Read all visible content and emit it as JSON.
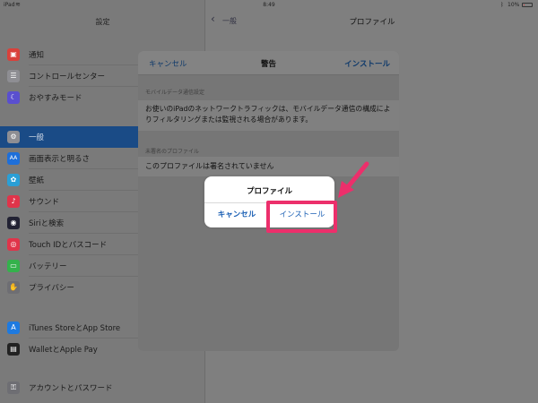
{
  "status_bar": {
    "carrier": "iPad",
    "time": "8:49",
    "battery": "10%"
  },
  "sidebar": {
    "title": "設定",
    "items": [
      {
        "label": "通知",
        "icon": "notifications-icon",
        "color": "#d9413b"
      },
      {
        "label": "コントロールセンター",
        "icon": "control-center-icon",
        "color": "#8e8e93"
      },
      {
        "label": "おやすみモード",
        "icon": "moon-icon",
        "color": "#5a4fcf"
      },
      {
        "label": "一般",
        "icon": "gear-icon",
        "color": "#8e8e93"
      },
      {
        "label": "画面表示と明るさ",
        "icon": "display-icon",
        "color": "#1e6fd9"
      },
      {
        "label": "壁紙",
        "icon": "wallpaper-icon",
        "color": "#2a9fd6"
      },
      {
        "label": "サウンド",
        "icon": "sound-icon",
        "color": "#e0344a"
      },
      {
        "label": "Siriと検索",
        "icon": "siri-icon",
        "color": "#222233"
      },
      {
        "label": "Touch IDとパスコード",
        "icon": "fingerprint-icon",
        "color": "#e0344a"
      },
      {
        "label": "バッテリー",
        "icon": "battery-icon",
        "color": "#34b24c"
      },
      {
        "label": "プライバシー",
        "icon": "privacy-hand-icon",
        "color": "#6e6e73"
      },
      {
        "label": "iTunes StoreとApp Store",
        "icon": "app-store-icon",
        "color": "#1e7ae0"
      },
      {
        "label": "WalletとApple Pay",
        "icon": "wallet-icon",
        "color": "#222222"
      },
      {
        "label": "アカウントとパスワード",
        "icon": "key-icon",
        "color": "#6e6e73"
      }
    ]
  },
  "detail": {
    "back_label": "一般",
    "title": "プロファイル"
  },
  "modal": {
    "cancel": "キャンセル",
    "title": "警告",
    "install": "インストール",
    "section1_header": "モバイルデータ通信設定",
    "section1_text": "お使いのiPadのネットワークトラフィックは、モバイルデータ通信の構成によりフィルタリングまたは監視される場合があります。",
    "section2_header": "未署名のプロファイル",
    "section2_text": "このプロファイルは署名されていません"
  },
  "alert": {
    "title": "プロファイル",
    "cancel": "キャンセル",
    "install": "インストール"
  },
  "annotation": {
    "highlight_color": "#ec2f6b"
  }
}
